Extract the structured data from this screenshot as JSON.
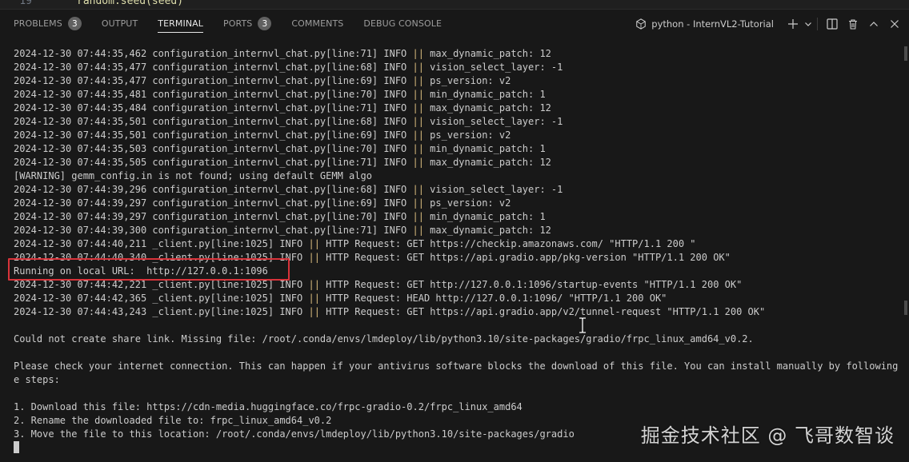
{
  "editor": {
    "line_number": "19",
    "code_line": "random.seed(seed)"
  },
  "panel": {
    "tabs": [
      {
        "label": "PROBLEMS",
        "badge": "3"
      },
      {
        "label": "OUTPUT"
      },
      {
        "label": "TERMINAL",
        "active": true
      },
      {
        "label": "PORTS",
        "badge": "3"
      },
      {
        "label": "COMMENTS"
      },
      {
        "label": "DEBUG CONSOLE"
      }
    ],
    "terminal_name": "python - InternVL2-Tutorial",
    "icons": [
      "python-icon",
      "plus-icon",
      "chevron-down-icon",
      "split-terminal-icon",
      "trash-icon",
      "chevron-up-icon",
      "close-icon"
    ]
  },
  "terminal": {
    "lines": [
      "2024-12-30 07:44:35,462 configuration_internvl_chat.py[line:71] INFO || max_dynamic_patch: 12",
      "2024-12-30 07:44:35,477 configuration_internvl_chat.py[line:68] INFO || vision_select_layer: -1",
      "2024-12-30 07:44:35,477 configuration_internvl_chat.py[line:69] INFO || ps_version: v2",
      "2024-12-30 07:44:35,481 configuration_internvl_chat.py[line:70] INFO || min_dynamic_patch: 1",
      "2024-12-30 07:44:35,484 configuration_internvl_chat.py[line:71] INFO || max_dynamic_patch: 12",
      "2024-12-30 07:44:35,501 configuration_internvl_chat.py[line:68] INFO || vision_select_layer: -1",
      "2024-12-30 07:44:35,501 configuration_internvl_chat.py[line:69] INFO || ps_version: v2",
      "2024-12-30 07:44:35,503 configuration_internvl_chat.py[line:70] INFO || min_dynamic_patch: 1",
      "2024-12-30 07:44:35,505 configuration_internvl_chat.py[line:71] INFO || max_dynamic_patch: 12",
      "[WARNING] gemm_config.in is not found; using default GEMM algo",
      "2024-12-30 07:44:39,296 configuration_internvl_chat.py[line:68] INFO || vision_select_layer: -1",
      "2024-12-30 07:44:39,297 configuration_internvl_chat.py[line:69] INFO || ps_version: v2",
      "2024-12-30 07:44:39,297 configuration_internvl_chat.py[line:70] INFO || min_dynamic_patch: 1",
      "2024-12-30 07:44:39,300 configuration_internvl_chat.py[line:71] INFO || max_dynamic_patch: 12",
      "2024-12-30 07:44:40,211 _client.py[line:1025] INFO || HTTP Request: GET https://checkip.amazonaws.com/ \"HTTP/1.1 200 \"",
      "2024-12-30 07:44:40,340 _client.py[line:1025] INFO || HTTP Request: GET https://api.gradio.app/pkg-version \"HTTP/1.1 200 OK\"",
      "Running on local URL:  http://127.0.0.1:1096",
      "2024-12-30 07:44:42,221 _client.py[line:1025] INFO || HTTP Request: GET http://127.0.0.1:1096/startup-events \"HTTP/1.1 200 OK\"",
      "2024-12-30 07:44:42,365 _client.py[line:1025] INFO || HTTP Request: HEAD http://127.0.0.1:1096/ \"HTTP/1.1 200 OK\"",
      "2024-12-30 07:44:43,243 _client.py[line:1025] INFO || HTTP Request: GET https://api.gradio.app/v2/tunnel-request \"HTTP/1.1 200 OK\"",
      "",
      "Could not create share link. Missing file: /root/.conda/envs/lmdeploy/lib/python3.10/site-packages/gradio/frpc_linux_amd64_v0.2.",
      "",
      "Please check your internet connection. This can happen if your antivirus software blocks the download of this file. You can install manually by following the",
      "e steps:",
      "",
      "1. Download this file: https://cdn-media.huggingface.co/frpc-gradio-0.2/frpc_linux_amd64",
      "2. Rename the downloaded file to: frpc_linux_amd64_v0.2",
      "3. Move the file to this location: /root/.conda/envs/lmdeploy/lib/python3.10/site-packages/gradio"
    ]
  },
  "watermark": "掘金技术社区 @ 飞哥数智谈",
  "colors": {
    "background": "#181818",
    "text": "#cccccc",
    "highlight_box": "#d8333a",
    "badge": "#616161"
  }
}
